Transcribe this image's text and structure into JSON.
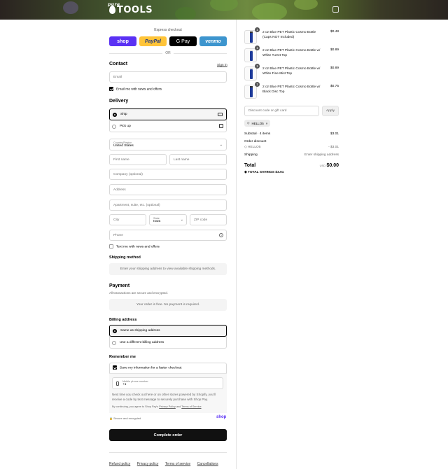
{
  "brand": {
    "prefix": "pure",
    "name": "TOOLS"
  },
  "express": {
    "label": "Express checkout",
    "or": "OR",
    "shop": "shop",
    "paypal": "PayPal",
    "gpay": "G Pay",
    "venmo": "venmo"
  },
  "contact": {
    "title": "Contact",
    "sign_in": "Sign in",
    "email_placeholder": "Email",
    "news": "Email me with news and offers"
  },
  "delivery": {
    "title": "Delivery",
    "ship": "Ship",
    "pickup": "Pick up",
    "country_label": "Country/Region",
    "country": "United States",
    "first": "First name",
    "last": "Last name",
    "company": "Company (optional)",
    "address": "Address",
    "apt": "Apartment, suite, etc. (optional)",
    "city": "City",
    "state_label": "State",
    "state": "Iowa",
    "zip": "ZIP code",
    "phone": "Phone",
    "text_me": "Text me with news and offers"
  },
  "shipping_method": {
    "title": "Shipping method",
    "note": "Enter your shipping address to view available shipping methods."
  },
  "payment": {
    "title": "Payment",
    "subtitle": "All transactions are secure and encrypted.",
    "note": "Your order is free. No payment is required."
  },
  "billing": {
    "title": "Billing address",
    "same": "Same as shipping address",
    "different": "Use a different billing address"
  },
  "remember": {
    "title": "Remember me",
    "save": "Save my information for a faster checkout",
    "mobile_label": "Mobile phone number",
    "mobile_value": "+1",
    "info": "Next time you check out here or on other stores powered by Shopify, you'll receive a code by text message to securely purchase with Shop Pay.",
    "terms_prefix": "By continuing, you agree to Shop Pay's",
    "privacy": "Privacy Policy",
    "and": "and",
    "terms": "Terms of Service",
    "secure": "Secure and encrypted",
    "shop": "shop"
  },
  "complete": "Complete order",
  "footer": [
    "Refund policy",
    "Privacy policy",
    "Terms of service",
    "Cancellations"
  ],
  "items": [
    {
      "qty": "1",
      "name": "2 oz Blue PET Plastic Cosmo Bottle (Caps NOT Included)",
      "price": "$0.48"
    },
    {
      "qty": "1",
      "name": "2 oz Blue PET Plastic Cosmo Bottle w/ White Turret Top",
      "price": "$0.89"
    },
    {
      "qty": "1",
      "name": "2 oz Blue PET Plastic Cosmo Bottle w/ White Fine Mist Top",
      "price": "$0.89"
    },
    {
      "qty": "1",
      "name": "2 oz Blue PET Plastic Cosmo Bottle w/ Black Disc Top",
      "price": "$0.75"
    }
  ],
  "discount": {
    "placeholder": "Discount code or gift card",
    "apply": "Apply",
    "code": "HELLO5"
  },
  "summary": {
    "subtotal_label": "Subtotal · 4 items",
    "subtotal": "$3.01",
    "order_discount": "Order discount",
    "code": "HELLO5",
    "discount": "- $3.01",
    "shipping_label": "Shipping",
    "shipping": "Enter shipping address",
    "total_label": "Total",
    "currency": "USD",
    "total": "$0.00",
    "savings_label": "TOTAL SAVINGS",
    "savings": "$3.01"
  }
}
